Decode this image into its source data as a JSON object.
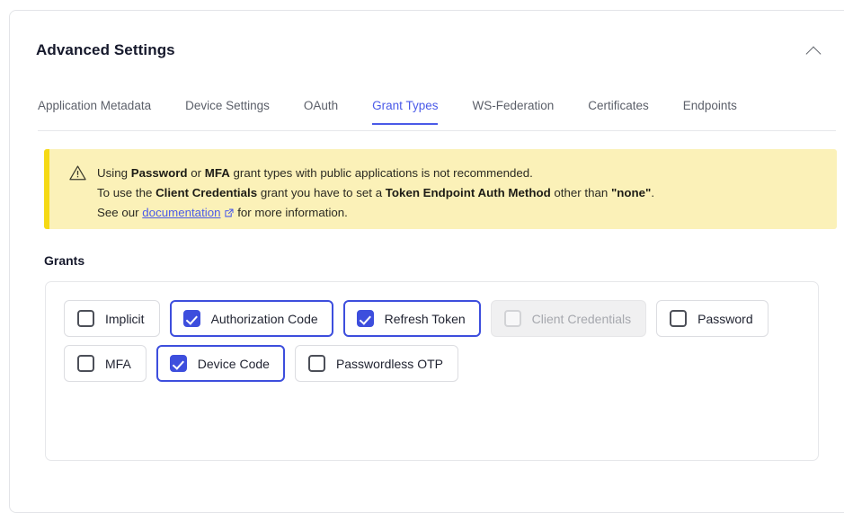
{
  "card": {
    "title": "Advanced Settings",
    "collapse_icon": "chevron-up-icon"
  },
  "tabs": [
    {
      "label": "Application Metadata",
      "active": false
    },
    {
      "label": "Device Settings",
      "active": false
    },
    {
      "label": "OAuth",
      "active": false
    },
    {
      "label": "Grant Types",
      "active": true
    },
    {
      "label": "WS-Federation",
      "active": false
    },
    {
      "label": "Certificates",
      "active": false
    },
    {
      "label": "Endpoints",
      "active": false
    }
  ],
  "banner": {
    "icon": "warning-triangle-icon",
    "accent_color": "#f5d915",
    "background_color": "#fbf1b8",
    "line1": {
      "a": "Using ",
      "b1": "Password",
      "c": " or ",
      "b2": "MFA",
      "d": " grant types with public applications is not recommended."
    },
    "line2": {
      "a": "To use the ",
      "b1": "Client Credentials",
      "c": " grant you have to set a ",
      "b2": "Token Endpoint Auth Method",
      "d": " other than ",
      "b3": "\"none\"",
      "e": "."
    },
    "line3": {
      "a": "See our ",
      "link": "documentation",
      "link_icon": "external-link-icon",
      "b": " for more information."
    }
  },
  "grants": {
    "label": "Grants",
    "accent_color": "#3d4edd",
    "rows": [
      [
        {
          "label": "Implicit",
          "checked": false,
          "disabled": false
        },
        {
          "label": "Authorization Code",
          "checked": true,
          "disabled": false
        },
        {
          "label": "Refresh Token",
          "checked": true,
          "disabled": false
        },
        {
          "label": "Client Credentials",
          "checked": false,
          "disabled": true
        },
        {
          "label": "Password",
          "checked": false,
          "disabled": false
        }
      ],
      [
        {
          "label": "MFA",
          "checked": false,
          "disabled": false
        },
        {
          "label": "Device Code",
          "checked": true,
          "disabled": false
        },
        {
          "label": "Passwordless OTP",
          "checked": false,
          "disabled": false
        }
      ]
    ]
  }
}
